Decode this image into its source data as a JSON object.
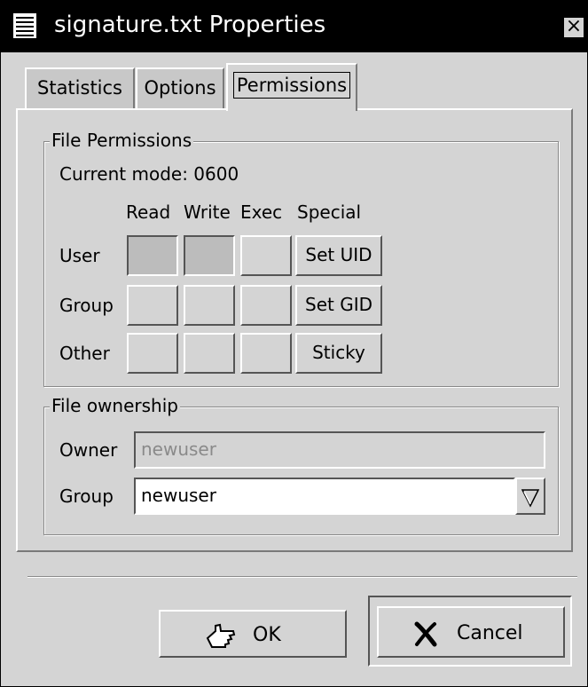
{
  "window": {
    "title": "signature.txt Properties"
  },
  "tabs": [
    {
      "label": "Statistics",
      "active": false
    },
    {
      "label": "Options",
      "active": false
    },
    {
      "label": "Permissions",
      "active": true
    }
  ],
  "permissions": {
    "frame_title": "File Permissions",
    "current_mode": "Current mode: 0600",
    "columns": [
      "Read",
      "Write",
      "Exec",
      "Special"
    ],
    "rows": [
      {
        "label": "User",
        "read": true,
        "write": true,
        "exec": false,
        "special_label": "Set UID",
        "special": false
      },
      {
        "label": "Group",
        "read": false,
        "write": false,
        "exec": false,
        "special_label": "Set GID",
        "special": false
      },
      {
        "label": "Other",
        "read": false,
        "write": false,
        "exec": false,
        "special_label": "Sticky",
        "special": false
      }
    ]
  },
  "ownership": {
    "frame_title": "File ownership",
    "owner_label": "Owner",
    "owner_value": "newuser",
    "group_label": "Group",
    "group_value": "newuser"
  },
  "buttons": {
    "ok_label": "OK",
    "cancel_label": "Cancel",
    "ok_icon": "ok-hand-icon",
    "cancel_icon": "x-cancel-icon"
  }
}
